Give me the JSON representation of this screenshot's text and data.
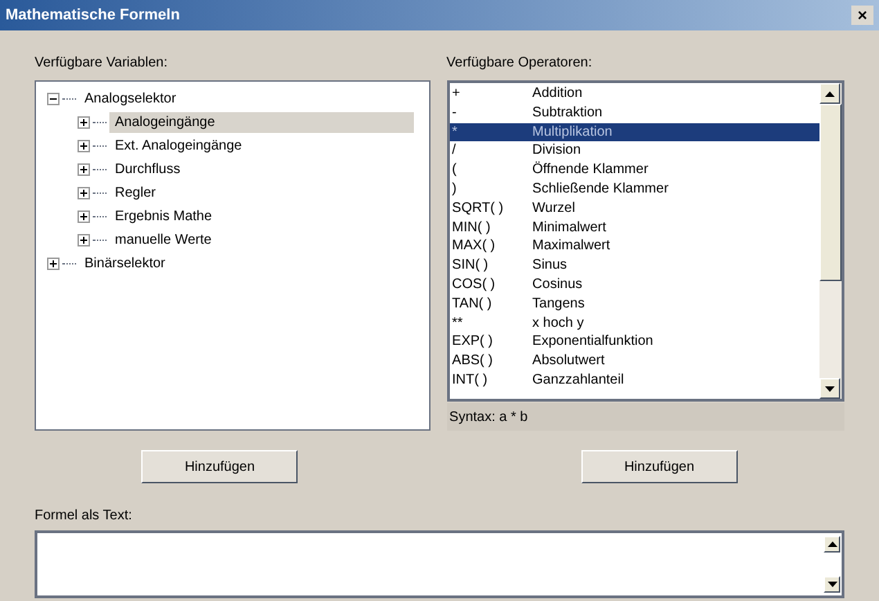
{
  "window": {
    "title": "Mathematische Formeln",
    "close": "×"
  },
  "variables": {
    "label": "Verfügbare Variablen:",
    "tree": [
      {
        "label": "Analogselektor",
        "expanded": true,
        "selected": false,
        "children": [
          {
            "label": "Analogeingänge",
            "expanded": false,
            "selected": true
          },
          {
            "label": "Ext. Analogeingänge",
            "expanded": false,
            "selected": false
          },
          {
            "label": "Durchfluss",
            "expanded": false,
            "selected": false
          },
          {
            "label": "Regler",
            "expanded": false,
            "selected": false
          },
          {
            "label": "Ergebnis Mathe",
            "expanded": false,
            "selected": false
          },
          {
            "label": "manuelle Werte",
            "expanded": false,
            "selected": false
          }
        ]
      },
      {
        "label": "Binärselektor",
        "expanded": false,
        "selected": false
      }
    ]
  },
  "operators": {
    "label": "Verfügbare Operatoren:",
    "rows": [
      {
        "symbol": "+",
        "name": "Addition",
        "selected": false
      },
      {
        "symbol": "-",
        "name": "Subtraktion",
        "selected": false
      },
      {
        "symbol": "*",
        "name": "Multiplikation",
        "selected": true
      },
      {
        "symbol": "/",
        "name": "Division",
        "selected": false
      },
      {
        "symbol": "(",
        "name": "Öffnende Klammer",
        "selected": false
      },
      {
        "symbol": ")",
        "name": "Schließende Klammer",
        "selected": false
      },
      {
        "symbol": "SQRT( )",
        "name": "Wurzel",
        "selected": false
      },
      {
        "symbol": "MIN( )",
        "name": "Minimalwert",
        "selected": false
      },
      {
        "symbol": "MAX( )",
        "name": "Maximalwert",
        "selected": false
      },
      {
        "symbol": "SIN( )",
        "name": "Sinus",
        "selected": false
      },
      {
        "symbol": "COS( )",
        "name": "Cosinus",
        "selected": false
      },
      {
        "symbol": "TAN( )",
        "name": "Tangens",
        "selected": false
      },
      {
        "symbol": "**",
        "name": "x hoch y",
        "selected": false
      },
      {
        "symbol": "EXP( )",
        "name": "Exponentialfunktion",
        "selected": false
      },
      {
        "symbol": "ABS( )",
        "name": "Absolutwert",
        "selected": false
      },
      {
        "symbol": "INT( )",
        "name": "Ganzzahlanteil",
        "selected": false
      }
    ],
    "syntax": "Syntax: a * b"
  },
  "buttons": [
    "Hinzufügen",
    "Hinzufügen"
  ],
  "formula": {
    "label": "Formel als Text:"
  }
}
